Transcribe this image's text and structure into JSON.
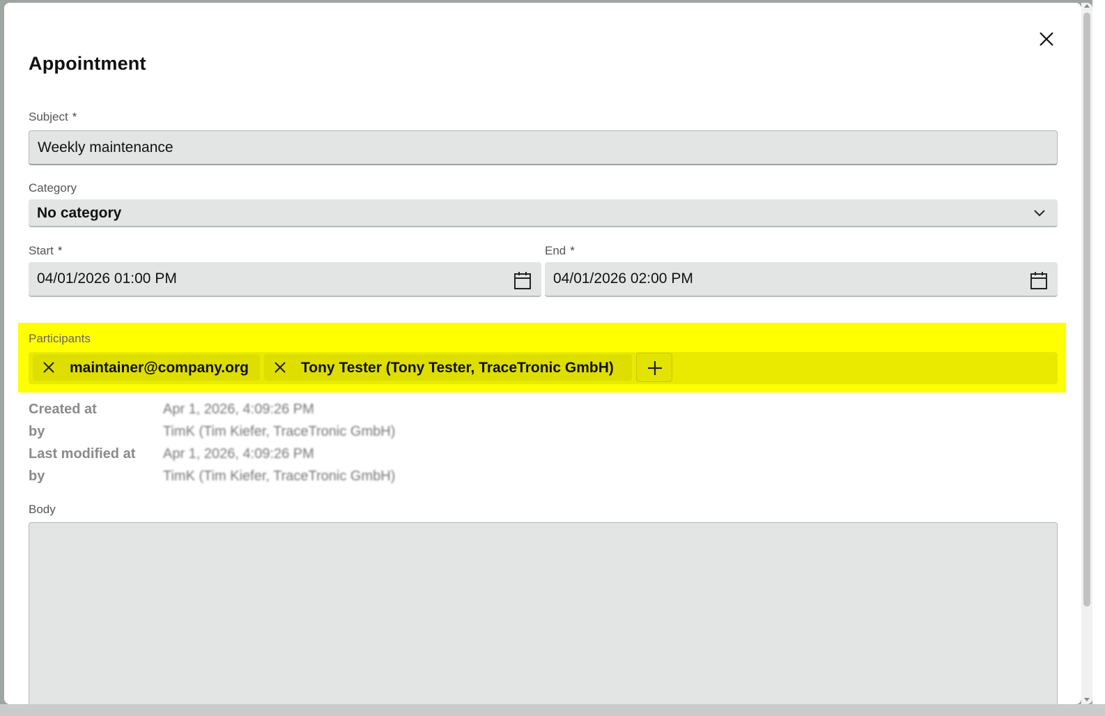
{
  "dialog": {
    "title": "Appointment",
    "close_icon": "close-icon"
  },
  "subject": {
    "label": "Subject",
    "required_mark": "*",
    "value": "Weekly maintenance"
  },
  "category": {
    "label": "Category",
    "value": "No category",
    "icon": "chevron-down-icon"
  },
  "start": {
    "label": "Start",
    "required_mark": "*",
    "value": "04/01/2026 01:00 PM",
    "icon": "calendar-icon"
  },
  "end": {
    "label": "End",
    "required_mark": "*",
    "value": "04/01/2026 02:00 PM",
    "icon": "calendar-icon"
  },
  "participants": {
    "label": "Participants",
    "highlight_color": "#ffff00",
    "chips": [
      {
        "text": "maintainer@company.org",
        "remove_icon": "close-icon"
      },
      {
        "text": "Tony Tester (Tony Tester, TraceTronic GmbH)",
        "remove_icon": "close-icon"
      }
    ],
    "add_icon": "plus-icon"
  },
  "meta": {
    "created_at_label": "Created at",
    "created_at_value": "Apr 1, 2026, 4:09:26 PM",
    "created_by_label": "by",
    "created_by_value": "TimK (Tim Kiefer, TraceTronic GmbH)",
    "modified_at_label": "Last modified at",
    "modified_at_value": "Apr 1, 2026, 4:09:26 PM",
    "modified_by_label": "by",
    "modified_by_value": "TimK (Tim Kiefer, TraceTronic GmbH)"
  },
  "body": {
    "label": "Body",
    "value": ""
  }
}
